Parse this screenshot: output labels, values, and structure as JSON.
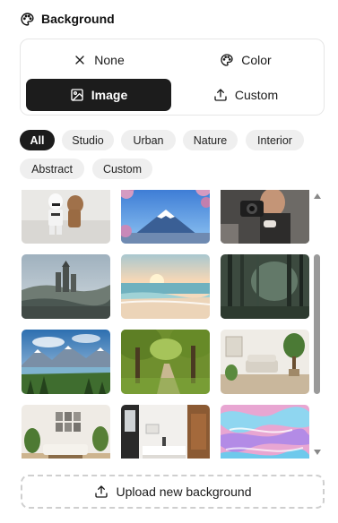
{
  "panel": {
    "title": "Background",
    "title_icon": "palette-icon"
  },
  "modes": {
    "none": {
      "label": "None",
      "icon": "close-icon"
    },
    "color": {
      "label": "Color",
      "icon": "palette-icon"
    },
    "image": {
      "label": "Image",
      "icon": "image-icon",
      "selected": true
    },
    "custom": {
      "label": "Custom",
      "icon": "upload-icon"
    }
  },
  "categories": [
    {
      "label": "All",
      "active": true
    },
    {
      "label": "Studio",
      "active": false
    },
    {
      "label": "Urban",
      "active": false
    },
    {
      "label": "Nature",
      "active": false
    },
    {
      "label": "Interior",
      "active": false
    },
    {
      "label": "Abstract",
      "active": false
    },
    {
      "label": "Custom",
      "active": false
    }
  ],
  "gallery": {
    "thumbnails": [
      "stormtrooper-toy",
      "mount-fuji-blossoms",
      "person-with-camera",
      "misty-castle",
      "beach-sunset",
      "misty-forest",
      "mountain-lake-valley",
      "tree-lined-path",
      "living-room-plants",
      "modern-living-room",
      "modern-kitchen",
      "pink-blue-fluid-art"
    ]
  },
  "upload": {
    "label": "Upload new background",
    "icon": "upload-icon"
  },
  "colors": {
    "selected_bg": "#1c1c1c",
    "chip_bg": "#efefef",
    "border": "#e6e6e6"
  }
}
